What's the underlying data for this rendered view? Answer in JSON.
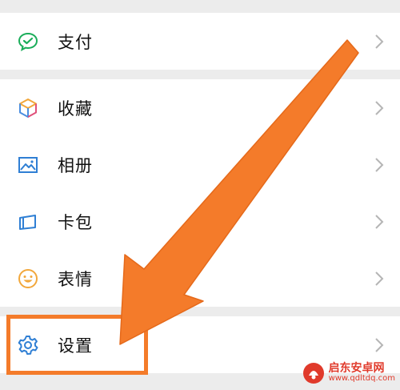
{
  "menu": {
    "items": [
      {
        "label": "支付",
        "icon": "wechat-pay-icon"
      },
      {
        "label": "收藏",
        "icon": "favorites-cube-icon"
      },
      {
        "label": "相册",
        "icon": "album-icon"
      },
      {
        "label": "卡包",
        "icon": "card-wallet-icon"
      },
      {
        "label": "表情",
        "icon": "emoji-smile-icon"
      },
      {
        "label": "设置",
        "icon": "gear-icon"
      }
    ]
  },
  "annotation": {
    "arrow_color": "#f47b2a",
    "highlight_color": "#f47b2a"
  },
  "watermark": {
    "title": "启东安卓网",
    "url": "www.qdltdq.com"
  }
}
